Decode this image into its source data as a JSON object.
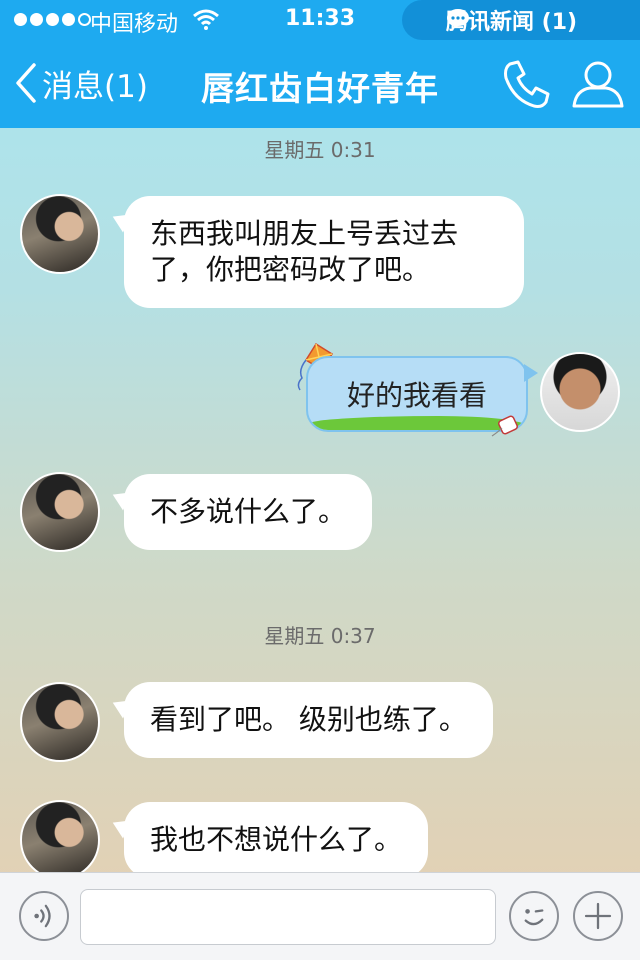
{
  "status_bar": {
    "carrier": "中国移动",
    "time": "11:33",
    "notification": "腾讯新闻 (1)"
  },
  "nav": {
    "back_label": "消息(1)",
    "title": "唇红齿白好青年"
  },
  "conversation": {
    "timestamps": [
      "星期五 0:31",
      "星期五 0:37"
    ],
    "messages": [
      {
        "side": "left",
        "text": "东西我叫朋友上号丢过去了，你把密码改了吧。"
      },
      {
        "side": "right",
        "text": "好的我看看"
      },
      {
        "side": "left",
        "text": "不多说什么了。"
      },
      {
        "side": "left",
        "text": "看到了吧。 级别也练了。"
      },
      {
        "side": "left",
        "text": "我也不想说什么了。"
      }
    ]
  },
  "input_bar": {
    "text_value": "",
    "placeholder": ""
  },
  "colors": {
    "header_blue": "#1eaaf0",
    "bubble_left": "#ffffff",
    "bubble_right": "#b6ddf6"
  }
}
